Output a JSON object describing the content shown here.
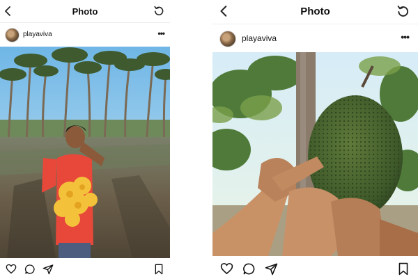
{
  "posts": [
    {
      "header": {
        "title": "Photo",
        "back_icon": "chevron-left-icon",
        "refresh_icon": "refresh-icon"
      },
      "author": {
        "username": "playaviva",
        "more_label": "•••"
      },
      "photo": {
        "subject": "boy-with-yellow-flowers-in-palm-grove"
      },
      "actions": [
        "heart-icon",
        "comment-icon",
        "send-icon",
        "bookmark-icon"
      ]
    },
    {
      "header": {
        "title": "Photo",
        "back_icon": "chevron-left-icon",
        "refresh_icon": "refresh-icon"
      },
      "author": {
        "username": "playaviva",
        "more_label": "•••"
      },
      "photo": {
        "subject": "hands-holding-jackfruit-on-tree"
      },
      "actions": [
        "heart-icon",
        "comment-icon",
        "send-icon",
        "bookmark-icon"
      ]
    }
  ]
}
